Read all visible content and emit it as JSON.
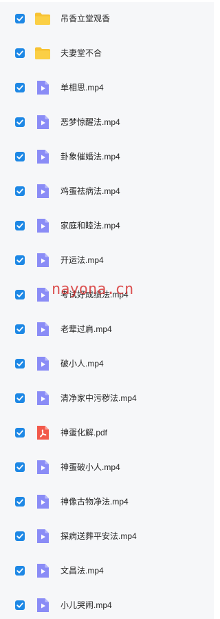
{
  "colors": {
    "checkbox": "#1e88e5",
    "folder": "#f7c233",
    "video": "#8a8cf6",
    "pdf": "#f2594b",
    "watermark": "#d63030"
  },
  "files": [
    {
      "name": "吊香立堂观香",
      "type": "folder",
      "icon": "folder-icon",
      "checked": true
    },
    {
      "name": "夫妻堂不合",
      "type": "folder",
      "icon": "folder-icon",
      "checked": true
    },
    {
      "name": "单相思.mp4",
      "type": "video",
      "icon": "video-file-icon",
      "checked": true
    },
    {
      "name": "恶梦惊醒法.mp4",
      "type": "video",
      "icon": "video-file-icon",
      "checked": true
    },
    {
      "name": "卦象催婚法.mp4",
      "type": "video",
      "icon": "video-file-icon",
      "checked": true
    },
    {
      "name": "鸡蛋祛病法.mp4",
      "type": "video",
      "icon": "video-file-icon",
      "checked": true
    },
    {
      "name": "家庭和睦法.mp4",
      "type": "video",
      "icon": "video-file-icon",
      "checked": true
    },
    {
      "name": "开运法.mp4",
      "type": "video",
      "icon": "video-file-icon",
      "checked": true
    },
    {
      "name": "考试好成绩法.mp4",
      "type": "video",
      "icon": "video-file-icon",
      "checked": true
    },
    {
      "name": "老辈过肩.mp4",
      "type": "video",
      "icon": "video-file-icon",
      "checked": true
    },
    {
      "name": "破小人.mp4",
      "type": "video",
      "icon": "video-file-icon",
      "checked": true
    },
    {
      "name": "清净家中污秽法.mp4",
      "type": "video",
      "icon": "video-file-icon",
      "checked": true
    },
    {
      "name": "神蛋化解.pdf",
      "type": "pdf",
      "icon": "pdf-file-icon",
      "checked": true
    },
    {
      "name": "神蛋破小人.mp4",
      "type": "video",
      "icon": "video-file-icon",
      "checked": true
    },
    {
      "name": "神像古物净法.mp4",
      "type": "video",
      "icon": "video-file-icon",
      "checked": true
    },
    {
      "name": "探病送葬平安法.mp4",
      "type": "video",
      "icon": "video-file-icon",
      "checked": true
    },
    {
      "name": "文昌法.mp4",
      "type": "video",
      "icon": "video-file-icon",
      "checked": true
    },
    {
      "name": "小儿哭闹.mp4",
      "type": "video",
      "icon": "video-file-icon",
      "checked": true
    }
  ],
  "watermark": {
    "text": "nayona.cn"
  }
}
